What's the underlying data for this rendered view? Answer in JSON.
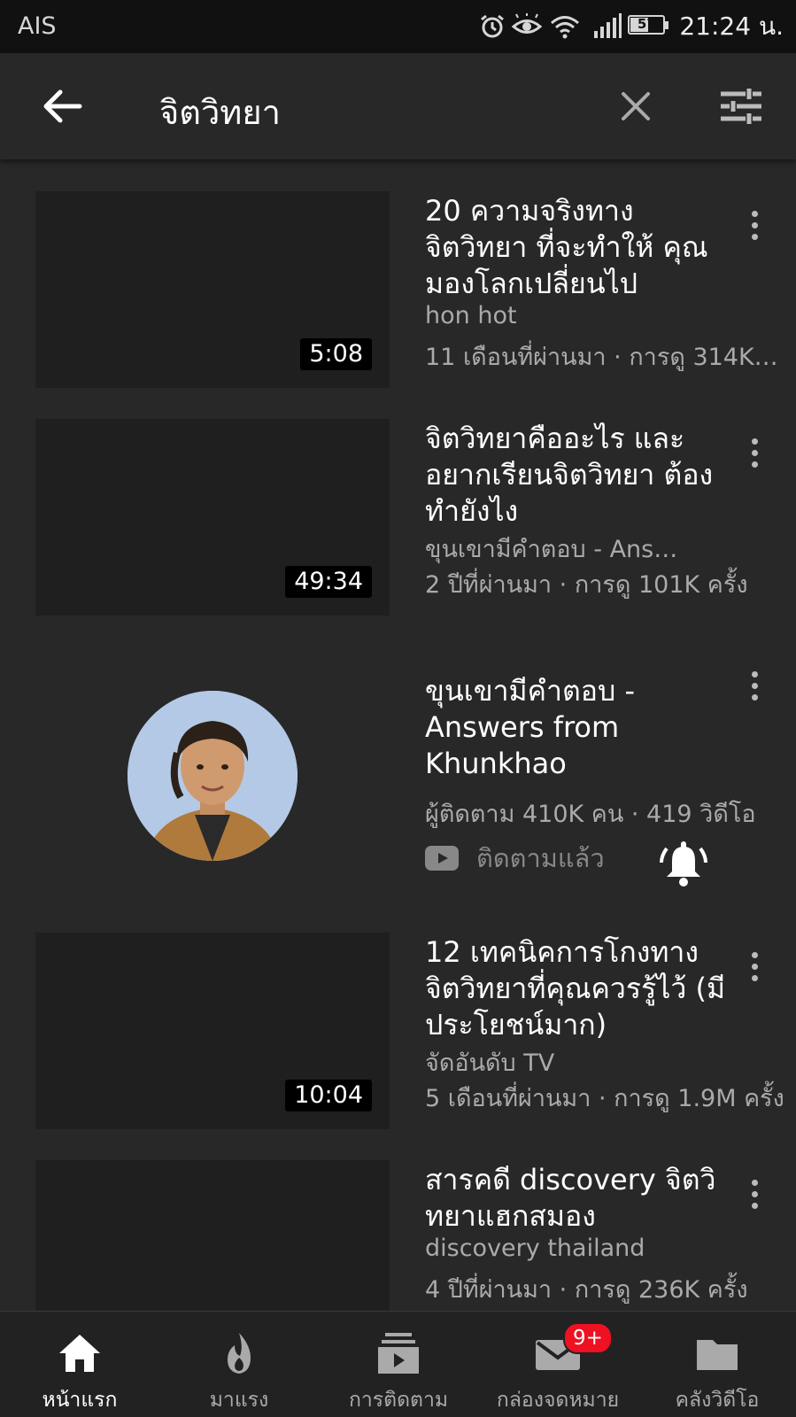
{
  "status_bar": {
    "carrier": "AIS",
    "battery": "57",
    "time": "21:24 น."
  },
  "search": {
    "query": "จิตวิทยา"
  },
  "results": [
    {
      "title": "20 ความจริงทาง จิตวิทยา ที่จะทำให้ คุณมองโลกเปลี่ยนไป",
      "channel": "hon hot",
      "meta": "11 เดือนที่ผ่านมา · การดู 314K…",
      "duration": "5:08"
    },
    {
      "title": "จิตวิทยาคืออะไร และ อยากเรียนจิตวิทยา ต้องทำยังไง",
      "channel": "ขุนเขามีคำตอบ - Answ…",
      "meta": "2 ปีที่ผ่านมา · การดู 101K ครั้ง",
      "duration": "49:34"
    },
    {
      "title": "12 เทคนิคการโกงทาง จิตวิทยาที่คุณควรรู้ไว้ (มีประโยชน์มาก)",
      "channel": "จัดอันดับ TV",
      "meta": "5 เดือนที่ผ่านมา · การดู 1.9M ครั้ง",
      "duration": "10:04"
    },
    {
      "title": "สารคดี discovery จิตวิทยาแฮกสมอง",
      "channel": "discovery thailand",
      "meta": "4 ปีที่ผ่านมา · การดู 236K ครั้ง",
      "duration": ""
    }
  ],
  "channel_result": {
    "title": "ขุนเขามีคำตอบ - Answers from Khunkhao",
    "stats": "ผู้ติดตาม 410K คน · 419 วิดีโอ",
    "subscribed_label": "ติดตามแล้ว"
  },
  "bottom_nav": [
    {
      "label": "หน้าแรก",
      "icon": "home-icon",
      "active": true
    },
    {
      "label": "มาแรง",
      "icon": "flame-icon",
      "active": false
    },
    {
      "label": "การติดตาม",
      "icon": "subscriptions-icon",
      "active": false
    },
    {
      "label": "กล่องจดหมาย",
      "icon": "mail-icon",
      "active": false,
      "badge": "9+"
    },
    {
      "label": "คลังวิดีโอ",
      "icon": "folder-icon",
      "active": false
    }
  ],
  "colors": {
    "background": "#282828",
    "status_bar": "#111111",
    "badge": "#ee1122",
    "secondary_text": "#aaaaaa"
  }
}
